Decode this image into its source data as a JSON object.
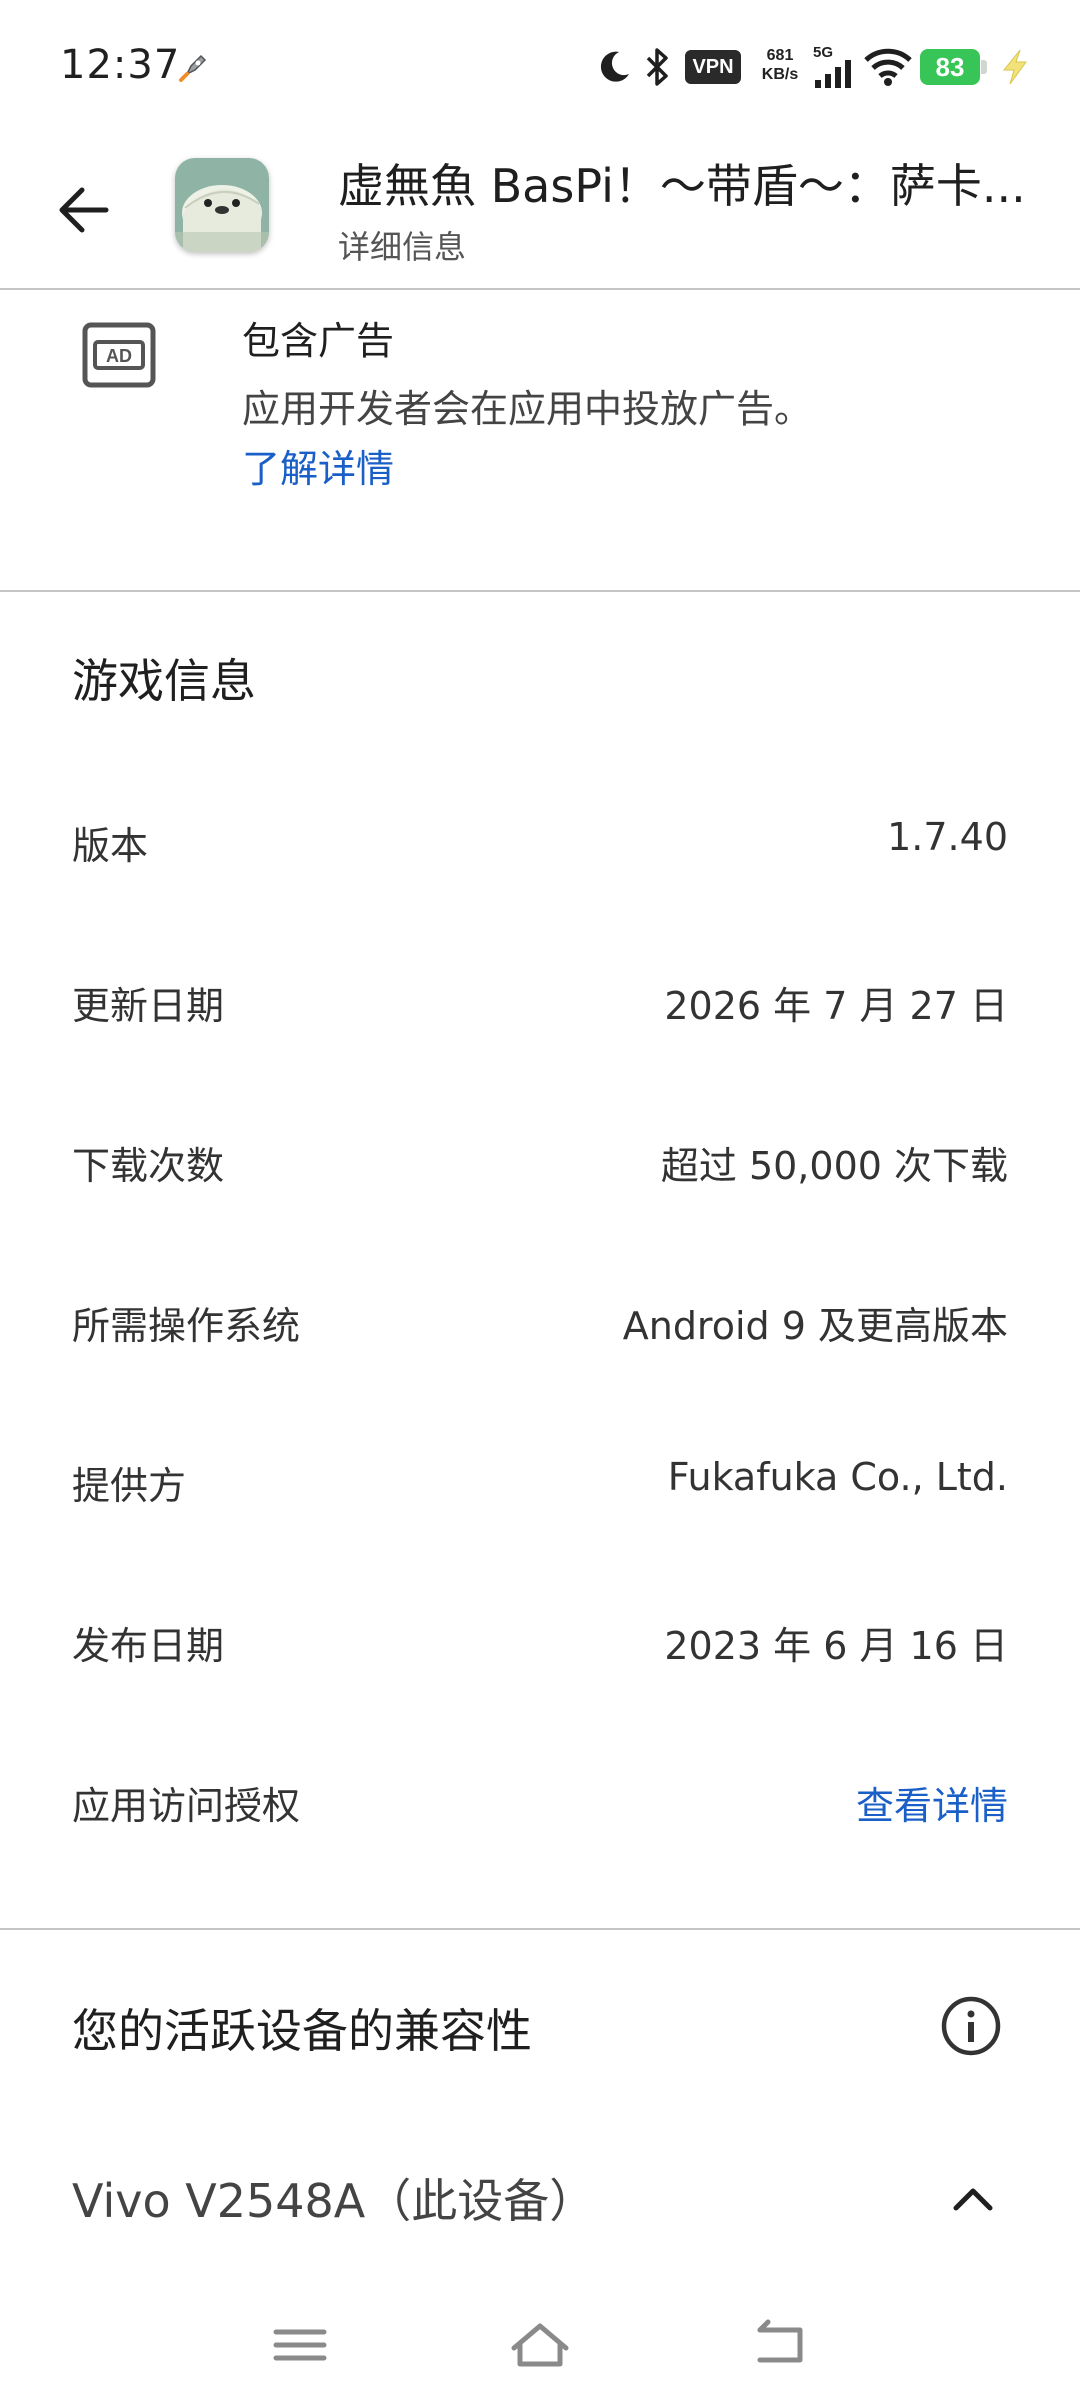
{
  "status_bar": {
    "time": "12:37",
    "vpn": "VPN",
    "net_speed_value": "681",
    "net_speed_unit": "KB/s",
    "network": "5G",
    "battery": "83",
    "icons": [
      "rocket-icon",
      "moon-icon",
      "bluetooth-icon",
      "vpn-icon",
      "signal-icon",
      "wifi-icon",
      "battery-icon",
      "charging-icon"
    ]
  },
  "header": {
    "title": "虚無魚 BasPi！～带盾～：萨卡...",
    "subtitle": "详细信息"
  },
  "ads": {
    "title": "包含广告",
    "description": "应用开发者会在应用中投放广告。",
    "link": "了解详情"
  },
  "game_info": {
    "title": "游戏信息",
    "rows": [
      {
        "label": "版本",
        "value": "1.7.40"
      },
      {
        "label": "更新日期",
        "value": "2026 年 7 月 27 日"
      },
      {
        "label": "下载次数",
        "value": "超过 50,000 次下载"
      },
      {
        "label": "所需操作系统",
        "value": "Android 9 及更高版本"
      },
      {
        "label": "提供方",
        "value": "Fukafuka Co., Ltd."
      },
      {
        "label": "发布日期",
        "value": "2023 年 6 月 16 日"
      },
      {
        "label": "应用访问授权",
        "value": "查看详情"
      }
    ]
  },
  "compatibility": {
    "title": "您的活跃设备的兼容性",
    "device": "Vivo V2548A（此设备）"
  },
  "colors": {
    "link": "#1a5fc7",
    "battery": "#36c556",
    "divider": "#c4c4c4"
  }
}
